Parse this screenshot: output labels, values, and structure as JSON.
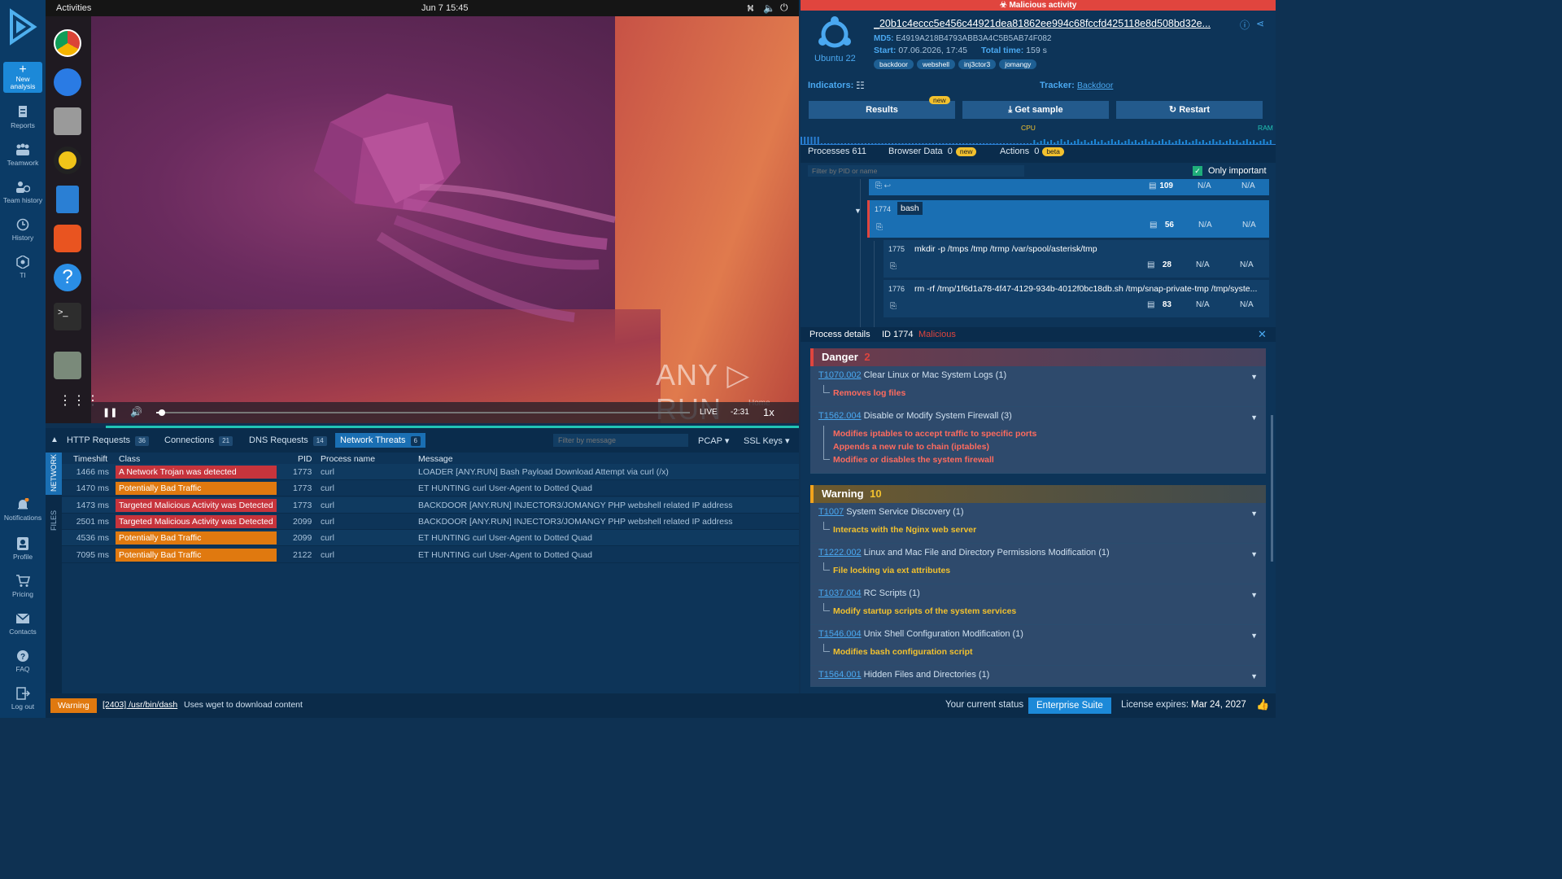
{
  "nav": {
    "new_analysis": "New analysis",
    "items": [
      "Reports",
      "Teamwork",
      "Team history",
      "History",
      "TI"
    ],
    "bottom": [
      "Notifications",
      "Profile",
      "Pricing",
      "Contacts",
      "FAQ",
      "Log out"
    ]
  },
  "vm": {
    "activities": "Activities",
    "clock": "Jun 7  15:45",
    "watermark": "ANY ▷ RUN",
    "live": "LIVE",
    "remaining": "-2:31",
    "speed": "1x",
    "home": "Home",
    "progress": 0.01
  },
  "network": {
    "tabs": [
      {
        "label": "HTTP Requests",
        "count": "36"
      },
      {
        "label": "Connections",
        "count": "21"
      },
      {
        "label": "DNS Requests",
        "count": "14"
      },
      {
        "label": "Network Threats",
        "count": "6"
      }
    ],
    "filter_placeholder": "Filter by message",
    "pcap": "PCAP",
    "ssl": "SSL Keys",
    "side_tabs": [
      "NETWORK",
      "FILES"
    ],
    "headers": {
      "timeshift": "Timeshift",
      "class": "Class",
      "pid": "PID",
      "process": "Process name",
      "message": "Message"
    },
    "rows": [
      {
        "time": "1466 ms",
        "class": "A Network Trojan was detected",
        "color": "#c7343c",
        "pid": "1773",
        "proc": "curl",
        "msg": "LOADER [ANY.RUN] Bash Payload Download Attempt via curl (/x)"
      },
      {
        "time": "1470 ms",
        "class": "Potentially Bad Traffic",
        "color": "#e0790f",
        "pid": "1773",
        "proc": "curl",
        "msg": "ET HUNTING curl User-Agent to Dotted Quad"
      },
      {
        "time": "1473 ms",
        "class": "Targeted Malicious Activity was Detected",
        "color": "#c7343c",
        "pid": "1773",
        "proc": "curl",
        "msg": "BACKDOOR [ANY.RUN] INJECTOR3/JOMANGY PHP webshell related IP address"
      },
      {
        "time": "2501 ms",
        "class": "Targeted Malicious Activity was Detected",
        "color": "#c7343c",
        "pid": "2099",
        "proc": "curl",
        "msg": "BACKDOOR [ANY.RUN] INJECTOR3/JOMANGY PHP webshell related IP address"
      },
      {
        "time": "4536 ms",
        "class": "Potentially Bad Traffic",
        "color": "#e0790f",
        "pid": "2099",
        "proc": "curl",
        "msg": "ET HUNTING curl User-Agent to Dotted Quad"
      },
      {
        "time": "7095 ms",
        "class": "Potentially Bad Traffic",
        "color": "#e0790f",
        "pid": "2122",
        "proc": "curl",
        "msg": "ET HUNTING curl User-Agent to Dotted Quad"
      }
    ]
  },
  "report": {
    "banner": "Malicious activity",
    "os": "Ubuntu 22",
    "filename": "_20b1c4eccc5e456c44921dea81862ee994c68fccfd425118e8d508bd32e...",
    "md5_label": "MD5:",
    "md5": "E4919A218B4793ABB3A4C5B5AB74F082",
    "start_label": "Start:",
    "start": "07.06.2026, 17:45",
    "total_label": "Total time:",
    "total": "159 s",
    "tags": [
      "backdoor",
      "webshell",
      "inj3ctor3",
      "jomangy"
    ],
    "indicators": "Indicators:",
    "tracker_label": "Tracker:",
    "tracker": "Backdoor",
    "btn_results": "Results",
    "btn_new": "new",
    "btn_sample": "Get sample",
    "btn_restart": "Restart",
    "cpu": "CPU",
    "ram": "RAM",
    "proc_tabs": {
      "processes": "Processes 611",
      "browser": "Browser Data",
      "browser_count": "0",
      "browser_badge": "new",
      "actions": "Actions",
      "actions_count": "0",
      "actions_badge": "beta"
    },
    "filter_placeholder": "Filter by PID or name",
    "only_important": "Only important",
    "processes": [
      {
        "pid": "",
        "name": "",
        "count": "109"
      },
      {
        "pid": "1774",
        "name": "bash",
        "count": "56"
      },
      {
        "pid": "1775",
        "name": "mkdir   -p /tmps /tmp /trmp /var/spool/asterisk/tmp",
        "count": "28"
      },
      {
        "pid": "1776",
        "name": "rm   -rf /tmp/1f6d1a78-4f47-4129-934b-4012f0bc18db.sh /tmp/snap-private-tmp /tmp/syste...",
        "count": "83"
      }
    ],
    "na": "N/A",
    "details_label": "Process details",
    "details_id": "ID 1774",
    "details_status": "Malicious",
    "danger": {
      "title": "Danger",
      "count": "2",
      "items": [
        {
          "id": "T1070.002",
          "name": "Clear Linux or Mac System Logs (1)",
          "behaviors": [
            "Removes log files"
          ]
        },
        {
          "id": "T1562.004",
          "name": "Disable or Modify System Firewall (3)",
          "behaviors": [
            "Modifies iptables to accept traffic to specific ports",
            "Appends a new rule to chain (iptables)",
            "Modifies or disables the system firewall"
          ]
        }
      ]
    },
    "warning": {
      "title": "Warning",
      "count": "10",
      "items": [
        {
          "id": "T1007",
          "name": "System Service Discovery (1)",
          "behaviors": [
            "Interacts with the Nginx web server"
          ]
        },
        {
          "id": "T1222.002",
          "name": "Linux and Mac File and Directory Permissions Modification (1)",
          "behaviors": [
            "File locking via ext attributes"
          ]
        },
        {
          "id": "T1037.004",
          "name": "RC Scripts (1)",
          "behaviors": [
            "Modify startup scripts of the system services"
          ]
        },
        {
          "id": "T1546.004",
          "name": "Unix Shell Configuration Modification (1)",
          "behaviors": [
            "Modifies bash configuration script"
          ]
        },
        {
          "id": "T1564.001",
          "name": "Hidden Files and Directories (1)",
          "behaviors": []
        }
      ]
    }
  },
  "status": {
    "level": "Warning",
    "proc": "[2403] /usr/bin/dash",
    "text": "Uses wget to download content",
    "current": "Your current status",
    "plan": "Enterprise Suite",
    "license": "License expires:",
    "date": "Mar 24, 2027"
  },
  "colors": {
    "danger": "#e0453e",
    "warning": "#f2a31c",
    "link": "#4aa8f0",
    "accent": "#1c89d8"
  }
}
